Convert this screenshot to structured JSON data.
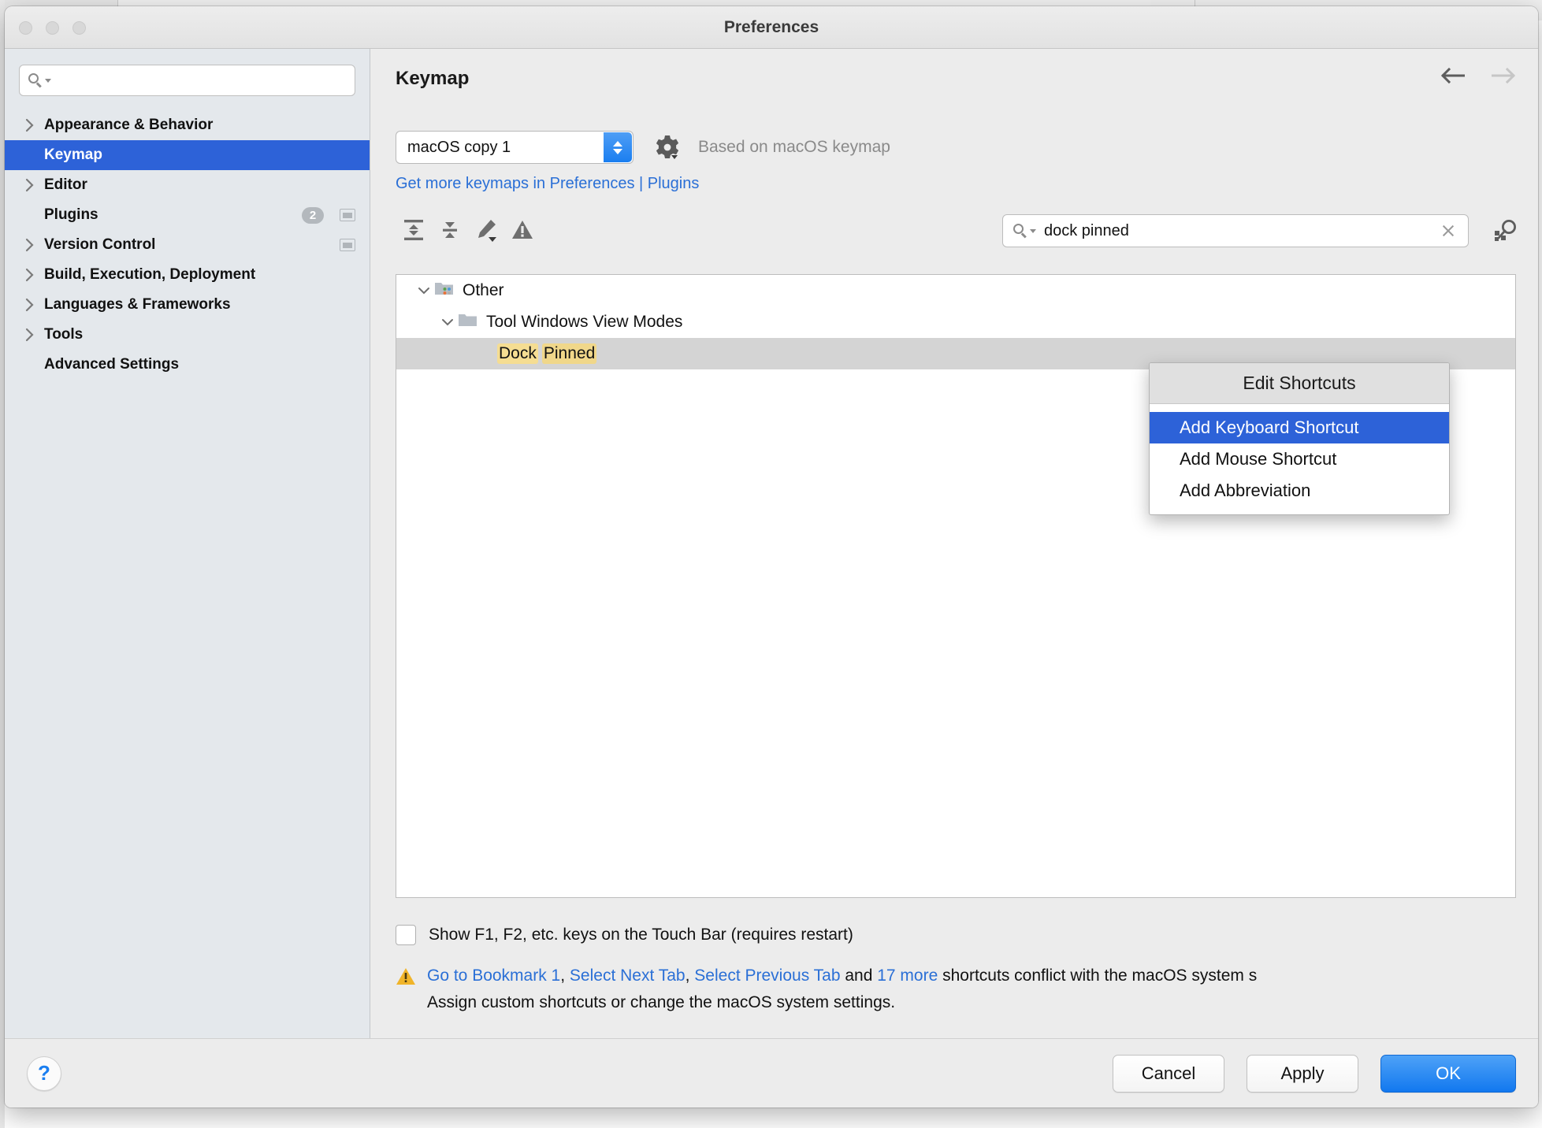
{
  "window": {
    "title": "Preferences"
  },
  "sidebar": {
    "search": {
      "value": "",
      "placeholder": ""
    },
    "items": [
      {
        "label": "Appearance & Behavior",
        "expandable": true,
        "selected": false,
        "badge": null,
        "window_icon": false
      },
      {
        "label": "Keymap",
        "expandable": false,
        "selected": true,
        "badge": null,
        "window_icon": false
      },
      {
        "label": "Editor",
        "expandable": true,
        "selected": false,
        "badge": null,
        "window_icon": false
      },
      {
        "label": "Plugins",
        "expandable": false,
        "selected": false,
        "badge": "2",
        "window_icon": true
      },
      {
        "label": "Version Control",
        "expandable": true,
        "selected": false,
        "badge": null,
        "window_icon": true
      },
      {
        "label": "Build, Execution, Deployment",
        "expandable": true,
        "selected": false,
        "badge": null,
        "window_icon": false
      },
      {
        "label": "Languages & Frameworks",
        "expandable": true,
        "selected": false,
        "badge": null,
        "window_icon": false
      },
      {
        "label": "Tools",
        "expandable": true,
        "selected": false,
        "badge": null,
        "window_icon": false
      },
      {
        "label": "Advanced Settings",
        "expandable": false,
        "selected": false,
        "badge": null,
        "window_icon": false
      }
    ]
  },
  "main": {
    "page_title": "Keymap",
    "keymap_select": {
      "value": "macOS copy 1"
    },
    "based_on": "Based on macOS keymap",
    "plugins_link": "Get more keymaps in Preferences | Plugins",
    "toolbar": [
      {
        "name": "expand-all-icon",
        "tooltip": "Expand All"
      },
      {
        "name": "collapse-all-icon",
        "tooltip": "Collapse All"
      },
      {
        "name": "edit-shortcut-icon",
        "tooltip": "Edit Shortcut"
      },
      {
        "name": "conflicts-icon",
        "tooltip": "Conflicts"
      }
    ],
    "tree_search": {
      "value": "dock pinned",
      "placeholder": ""
    },
    "tree": [
      {
        "label": "Other",
        "depth": 0,
        "expanded": true,
        "icon": "other-folder-icon",
        "selected": false,
        "highlights": []
      },
      {
        "label": "Tool Windows View Modes",
        "depth": 1,
        "expanded": true,
        "icon": "folder-icon",
        "selected": false,
        "highlights": []
      },
      {
        "label": "Dock Pinned",
        "depth": 2,
        "expanded": null,
        "icon": null,
        "selected": true,
        "highlights": [
          "Dock",
          "Pinned"
        ]
      }
    ],
    "touchbar_checkbox": {
      "label": "Show F1, F2, etc. keys on the Touch Bar (requires restart)",
      "checked": false
    },
    "conflict_warning": {
      "links": [
        "Go to Bookmark 1",
        "Select Next Tab",
        "Select Previous Tab",
        "17 more"
      ],
      "line1_before_more": " and ",
      "line1_tail": " shortcuts conflict with the macOS system s",
      "line2": "Assign custom shortcuts or change the macOS system settings.",
      "separator": ", "
    }
  },
  "context_menu": {
    "title": "Edit Shortcuts",
    "items": [
      {
        "label": "Add Keyboard Shortcut",
        "highlighted": true
      },
      {
        "label": "Add Mouse Shortcut",
        "highlighted": false
      },
      {
        "label": "Add Abbreviation",
        "highlighted": false
      }
    ]
  },
  "footer": {
    "help_label": "?",
    "cancel_label": "Cancel",
    "apply_label": "Apply",
    "ok_label": "OK"
  },
  "colors": {
    "accent_blue": "#2d62d8",
    "link_blue": "#2a6fd6",
    "primary_button": "#1278ef",
    "highlight_yellow": "#f5dd92",
    "sidebar_bg": "#e4e8ec",
    "panel_bg": "#ececec",
    "selected_row": "#d4d4d4",
    "warning_orange": "#f0b429"
  }
}
